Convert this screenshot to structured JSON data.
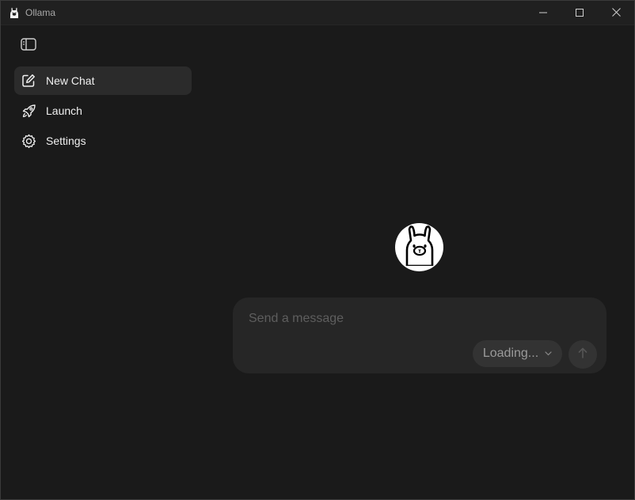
{
  "window": {
    "title": "Ollama",
    "icons": {
      "app": "llama-icon",
      "minimize": "minimize-icon",
      "maximize": "maximize-icon",
      "close": "close-icon"
    }
  },
  "sidebar": {
    "toggle_icon": "sidebar-toggle-icon",
    "items": [
      {
        "label": "New Chat",
        "icon": "compose-icon",
        "active": true
      },
      {
        "label": "Launch",
        "icon": "rocket-icon",
        "active": false
      },
      {
        "label": "Settings",
        "icon": "gear-icon",
        "active": false
      }
    ]
  },
  "main": {
    "logo_icon": "ollama-logo-icon",
    "composer": {
      "placeholder": "Send a message",
      "value": "",
      "model_label": "Loading...",
      "send_icon": "arrow-up-icon"
    }
  },
  "colors": {
    "background": "#1a1a1a",
    "titlebar": "#202020",
    "active_item": "#2b2b2b",
    "composer": "#262626",
    "pill": "#333333"
  }
}
